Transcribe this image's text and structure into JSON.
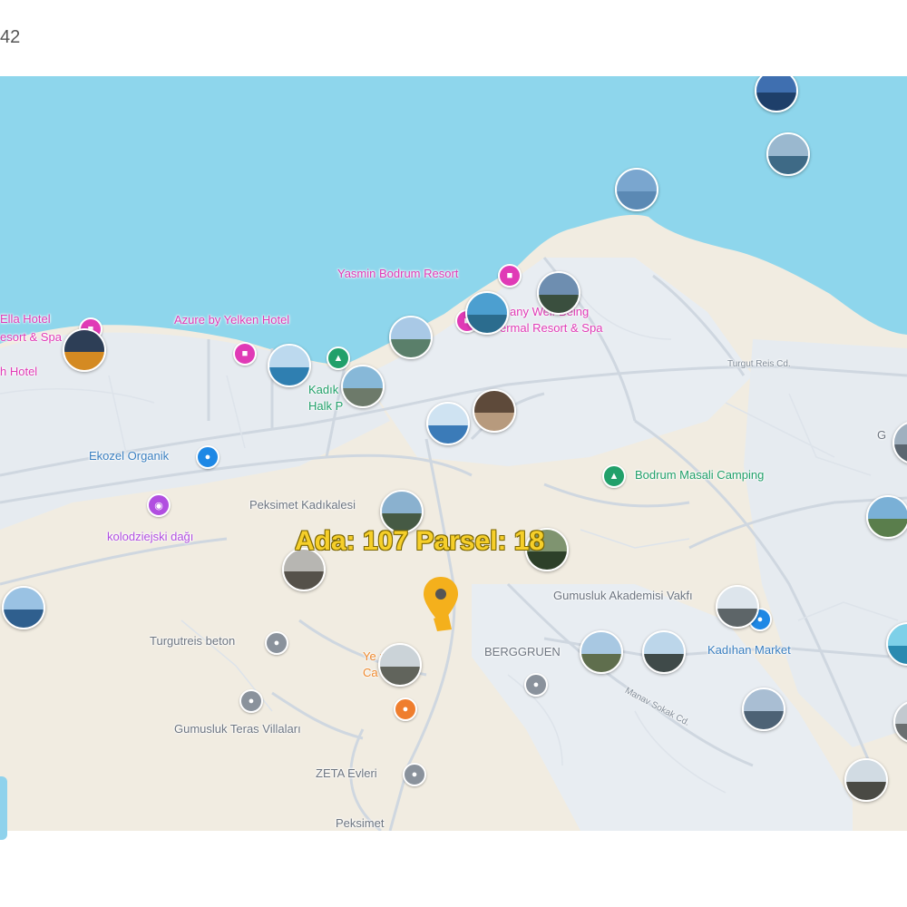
{
  "header": {
    "counter": "42"
  },
  "colors": {
    "sea": "#8ed6ec",
    "land": "#f1ece1",
    "urban": "#e6ebf0",
    "road": "#cfd7e0",
    "parcel_text": "#f6cf2a",
    "marker": "#f4b01c"
  },
  "parcel": {
    "label": "Ada: 107  Parsel: 18"
  },
  "places": {
    "yasmin": "Yasmin Bodrum Resort",
    "ella_1": "Ella Hotel",
    "ella_2": "esort & Spa",
    "ella_3": "h Hotel",
    "azure": "Azure by Yelken Hotel",
    "thermal_1": "any Well-Being",
    "thermal_2": "ermal Resort & Spa",
    "kadi_1": "Kadık",
    "kadi_2": "Halk P",
    "ekozel": "Ekozel Organik",
    "masali": "Bodrum Masali Camping",
    "kolodz": "kolodziejski dağı",
    "peksimet_kale": "Peksimet Kadıkalesi",
    "gumusluk_ak": "Gumusluk Akademisi Vakfı",
    "kadihan": "Kadıhan Market",
    "turgutreis_beton": "Turgutreis beton",
    "rest_1": "Ye      meni",
    "rest_2": "Ca      toran",
    "berggruen": "BERGGRUEN",
    "teras": "Gumusluk Teras Villaları",
    "zeta": "ZETA Evleri",
    "peksimet": "Peksimet",
    "g_edge": "G",
    "road_turgut": "Turgut Reis Cd.",
    "road_manav": "Manav Sokak Cd."
  },
  "icons": {
    "hotel": "hotel-icon",
    "park": "park-icon",
    "shop": "shopping-bag-icon",
    "camp": "camping-icon",
    "camera": "camera-icon",
    "poi": "poi-icon",
    "restaurant": "restaurant-icon",
    "marker": "location-marker-icon"
  }
}
